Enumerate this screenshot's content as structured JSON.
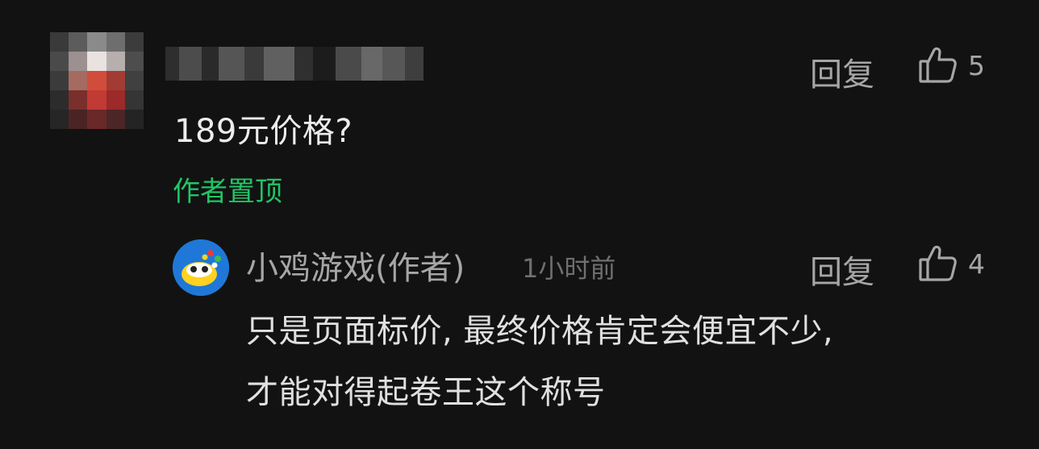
{
  "comment": {
    "text": "189元价格?",
    "pinned_label": "作者置顶",
    "reply_label": "回复",
    "like_count": "5",
    "like_icon": "thumbs-up-outline-icon",
    "avatar": "pixelated-avatar",
    "username": "pixelated-username"
  },
  "reply": {
    "author": "小鸡游戏(作者)",
    "time": "1小时前",
    "reply_label": "回复",
    "like_count": "4",
    "like_icon": "thumbs-up-outline-icon",
    "avatar": "xiaoji-game-logo",
    "lines": [
      "只是页面标价, 最终价格肯定会便宜不少,",
      "才能对得起卷王这个称号"
    ]
  },
  "colors": {
    "background": "#121212",
    "pinned_green": "#22c466",
    "secondary_text": "#a6a6a6",
    "primary_text": "#ececec",
    "avatar_blue": "#1f78d8"
  }
}
